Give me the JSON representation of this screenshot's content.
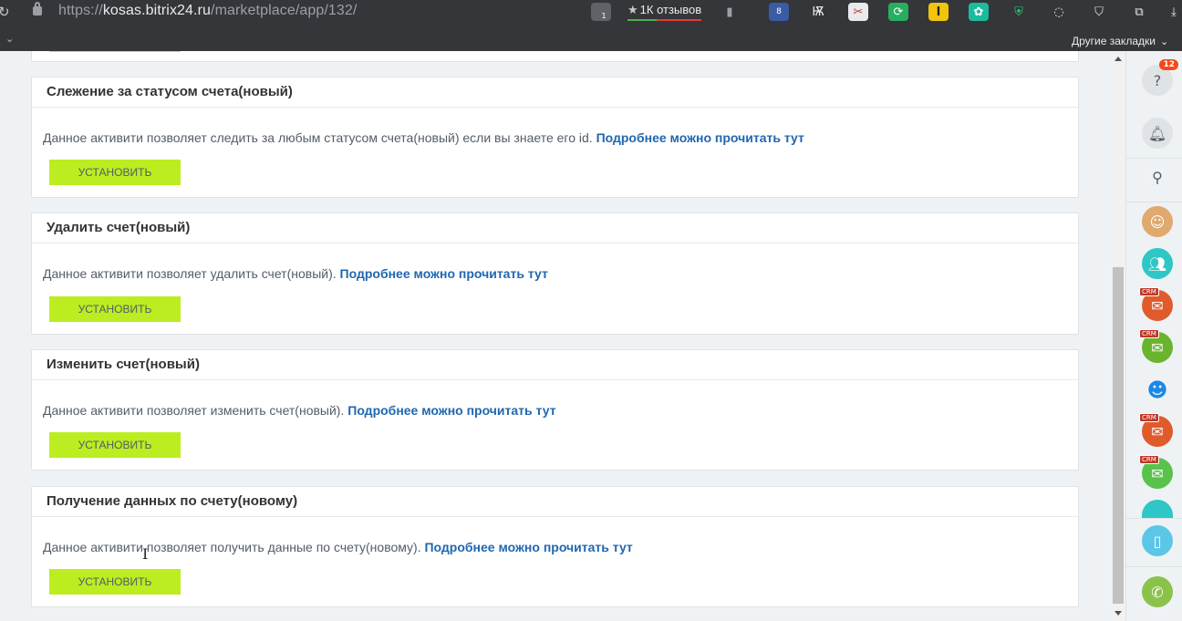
{
  "browser": {
    "url_prefix": "https://",
    "url_host": "kosas.bitrix24.ru",
    "url_path": "/marketplace/app/132/",
    "reviews_label": "1К отзывов",
    "ext_badge_1": "1",
    "ext_badge_2": "8",
    "other_bookmarks": "Другие закладки"
  },
  "cards": [
    {
      "title": "Слежение за статусом счета(новый)",
      "description": "Данное активити позволяет следить за любым статусом счета(новый) если вы знаете его id.",
      "link": "Подробнее можно прочитать тут",
      "button": "УСТАНОВИТЬ"
    },
    {
      "title": "Удалить счет(новый)",
      "description": "Данное активити позволяет удалить счет(новый).",
      "link": "Подробнее можно прочитать тут",
      "button": "УСТАНОВИТЬ"
    },
    {
      "title": "Изменить счет(новый)",
      "description": "Данное активити позволяет изменить счет(новый).",
      "link": "Подробнее можно прочитать тут",
      "button": "УСТАНОВИТЬ"
    },
    {
      "title": "Получение данных по счету(новому)",
      "description": "Данное активити позволяет получить данные по счету(новому).",
      "link": "Подробнее можно прочитать тут",
      "button": "УСТАНОВИТЬ"
    }
  ],
  "sidebar": {
    "help_badge": "12",
    "crm_label": "CRM"
  },
  "colors": {
    "accent_button": "#bbed21",
    "link": "#2067b0",
    "chrome_bg": "#35363a"
  }
}
